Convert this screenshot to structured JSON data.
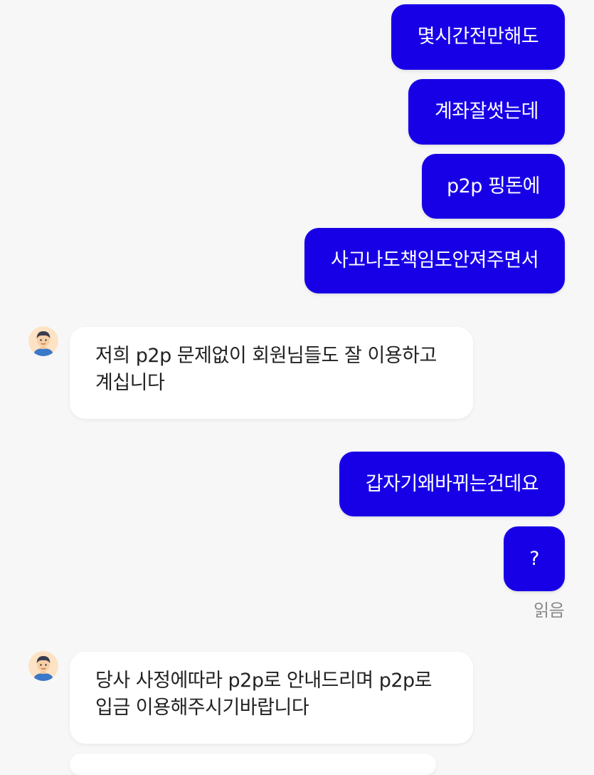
{
  "messages": {
    "m1": "몇시간전만해도",
    "m2": "계좌잘썻는데",
    "m3": "p2p 핑돈에",
    "m4": "사고나도책임도안져주면서",
    "r1": [
      "저희 p2p 문제없이 회원님들도 잘 이용하고",
      "계십니다"
    ],
    "m5": "갑자기왜바뀌는건데요",
    "m6": "?",
    "read_label": "읽음",
    "r2": [
      "당사 사정에따라 p2p로 안내드리며 p2p로",
      "입금 이용해주시기바랍니다"
    ]
  },
  "icons": {
    "agent_avatar": "agent-avatar-icon"
  },
  "colors": {
    "outgoing_bubble": "#1800e6",
    "incoming_bubble": "#ffffff",
    "background": "#f7f7f7"
  }
}
